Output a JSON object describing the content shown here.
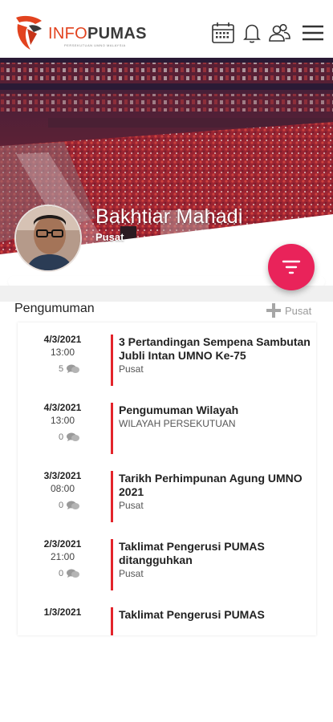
{
  "header": {
    "logo_info": "INFO",
    "logo_pumas": "PUMAS",
    "logo_subtitle": "PERSEKUTUAN UMNO MALAYSIA"
  },
  "icons": {
    "calendar": "calendar-icon",
    "bell": "bell-icon",
    "users": "users-icon",
    "menu": "menu-icon",
    "filter": "filter-icon",
    "plus": "plus-icon",
    "comment": "comment-icon"
  },
  "colors": {
    "accent_red": "#e3242b",
    "fab_pink": "#e9235a",
    "logo_orange": "#e2431f"
  },
  "profile": {
    "name": "Bakhtiar Mahadi",
    "division": "Pusat"
  },
  "section": {
    "title": "Pengumuman",
    "action_label": "Pusat"
  },
  "announcements": [
    {
      "date": "4/3/2021",
      "time": "13:00",
      "comments": "5",
      "title": "3 Pertandingan Sempena Sambutan Jubli Intan UMNO Ke-75",
      "sub": "Pusat"
    },
    {
      "date": "4/3/2021",
      "time": "13:00",
      "comments": "0",
      "title": "Pengumuman Wilayah",
      "sub": "WILAYAH PERSEKUTUAN"
    },
    {
      "date": "3/3/2021",
      "time": "08:00",
      "comments": "0",
      "title": "Tarikh Perhimpunan Agung UMNO 2021",
      "sub": "Pusat"
    },
    {
      "date": "2/3/2021",
      "time": "21:00",
      "comments": "0",
      "title": "Taklimat Pengerusi PUMAS ditangguhkan",
      "sub": "Pusat"
    },
    {
      "date": "1/3/2021",
      "time": "",
      "comments": "",
      "title": "Taklimat Pengerusi PUMAS",
      "sub": ""
    }
  ]
}
